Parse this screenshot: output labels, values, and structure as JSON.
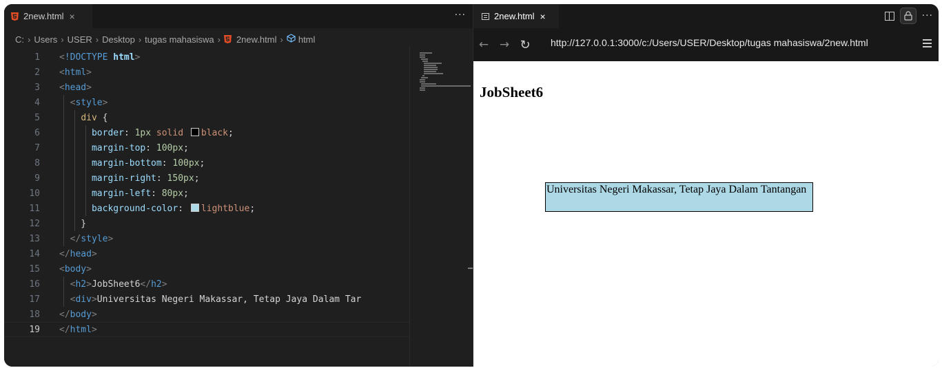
{
  "editor": {
    "tab": {
      "filename": "2new.html",
      "close": "×"
    },
    "more": "···",
    "breadcrumb": [
      "C:",
      "Users",
      "USER",
      "Desktop",
      "tugas mahasiswa",
      "2new.html",
      "html"
    ],
    "current_line": "19",
    "lines": [
      {
        "n": "1",
        "parts": [
          [
            "punct",
            "<"
          ],
          [
            "doc",
            "!DOCTYPE "
          ],
          [
            "bold",
            "html"
          ],
          [
            "punct",
            ">"
          ]
        ]
      },
      {
        "n": "2",
        "parts": [
          [
            "punct",
            "<"
          ],
          [
            "tag",
            "html"
          ],
          [
            "punct",
            ">"
          ]
        ]
      },
      {
        "n": "3",
        "parts": [
          [
            "punct",
            "<"
          ],
          [
            "tag",
            "head"
          ],
          [
            "punct",
            ">"
          ]
        ]
      },
      {
        "n": "4",
        "parts": [
          [
            "text",
            "  "
          ],
          [
            "punct",
            "<"
          ],
          [
            "tag",
            "style"
          ],
          [
            "punct",
            ">"
          ]
        ]
      },
      {
        "n": "5",
        "parts": [
          [
            "text",
            "    "
          ],
          [
            "sel",
            "div"
          ],
          [
            "text",
            " {"
          ]
        ]
      },
      {
        "n": "6",
        "parts": [
          [
            "text",
            "      "
          ],
          [
            "prop",
            "border"
          ],
          [
            "text",
            ": "
          ],
          [
            "num",
            "1px"
          ],
          [
            "text",
            " "
          ],
          [
            "val",
            "solid"
          ],
          [
            "text",
            " "
          ],
          [
            "swatch",
            "#000000"
          ],
          [
            "val",
            "black"
          ],
          [
            "text",
            ";"
          ]
        ]
      },
      {
        "n": "7",
        "parts": [
          [
            "text",
            "      "
          ],
          [
            "prop",
            "margin-top"
          ],
          [
            "text",
            ": "
          ],
          [
            "num",
            "100px"
          ],
          [
            "text",
            ";"
          ]
        ]
      },
      {
        "n": "8",
        "parts": [
          [
            "text",
            "      "
          ],
          [
            "prop",
            "margin-bottom"
          ],
          [
            "text",
            ": "
          ],
          [
            "num",
            "100px"
          ],
          [
            "text",
            ";"
          ]
        ]
      },
      {
        "n": "9",
        "parts": [
          [
            "text",
            "      "
          ],
          [
            "prop",
            "margin-right"
          ],
          [
            "text",
            ": "
          ],
          [
            "num",
            "150px"
          ],
          [
            "text",
            ";"
          ]
        ]
      },
      {
        "n": "10",
        "parts": [
          [
            "text",
            "      "
          ],
          [
            "prop",
            "margin-left"
          ],
          [
            "text",
            ": "
          ],
          [
            "num",
            "80px"
          ],
          [
            "text",
            ";"
          ]
        ]
      },
      {
        "n": "11",
        "parts": [
          [
            "text",
            "      "
          ],
          [
            "prop",
            "background-color"
          ],
          [
            "text",
            ": "
          ],
          [
            "swatch",
            "#add8e6"
          ],
          [
            "val",
            "lightblue"
          ],
          [
            "text",
            ";"
          ]
        ]
      },
      {
        "n": "12",
        "parts": [
          [
            "text",
            "    }"
          ]
        ]
      },
      {
        "n": "13",
        "parts": [
          [
            "text",
            "  "
          ],
          [
            "punct",
            "</"
          ],
          [
            "tag",
            "style"
          ],
          [
            "punct",
            ">"
          ]
        ]
      },
      {
        "n": "14",
        "parts": [
          [
            "punct",
            "</"
          ],
          [
            "tag",
            "head"
          ],
          [
            "punct",
            ">"
          ]
        ]
      },
      {
        "n": "15",
        "parts": [
          [
            "punct",
            "<"
          ],
          [
            "tag",
            "body"
          ],
          [
            "punct",
            ">"
          ]
        ]
      },
      {
        "n": "16",
        "parts": [
          [
            "text",
            "  "
          ],
          [
            "punct",
            "<"
          ],
          [
            "tag",
            "h2"
          ],
          [
            "punct",
            ">"
          ],
          [
            "text",
            "JobSheet6"
          ],
          [
            "punct",
            "</"
          ],
          [
            "tag",
            "h2"
          ],
          [
            "punct",
            ">"
          ]
        ]
      },
      {
        "n": "17",
        "parts": [
          [
            "text",
            "  "
          ],
          [
            "punct",
            "<"
          ],
          [
            "tag",
            "div"
          ],
          [
            "punct",
            ">"
          ],
          [
            "text",
            "Universitas Negeri Makassar, Tetap Jaya Dalam Tar"
          ]
        ]
      },
      {
        "n": "18",
        "parts": [
          [
            "punct",
            "</"
          ],
          [
            "tag",
            "body"
          ],
          [
            "punct",
            ">"
          ]
        ]
      },
      {
        "n": "19",
        "parts": [
          [
            "punct",
            "</"
          ],
          [
            "tag",
            "html"
          ],
          [
            "punct",
            ">"
          ]
        ]
      }
    ]
  },
  "browser": {
    "tab": {
      "title": "2new.html",
      "close": "×"
    },
    "more": "···",
    "nav": {
      "back": "←",
      "forward": "→",
      "reload": "↻"
    },
    "url": "http://127.0.0.1:3000/c:/Users/USER/Desktop/tugas mahasiswa/2new.html",
    "page": {
      "heading": "JobSheet6",
      "div_text": "Universitas Negeri Makassar, Tetap Jaya Dalam Tantangan"
    }
  },
  "colors": {
    "editor_bg": "#1f1f1f",
    "tab_bar_bg": "#181818",
    "html_icon": "#e44d26",
    "div_bg": "#add8e6"
  }
}
